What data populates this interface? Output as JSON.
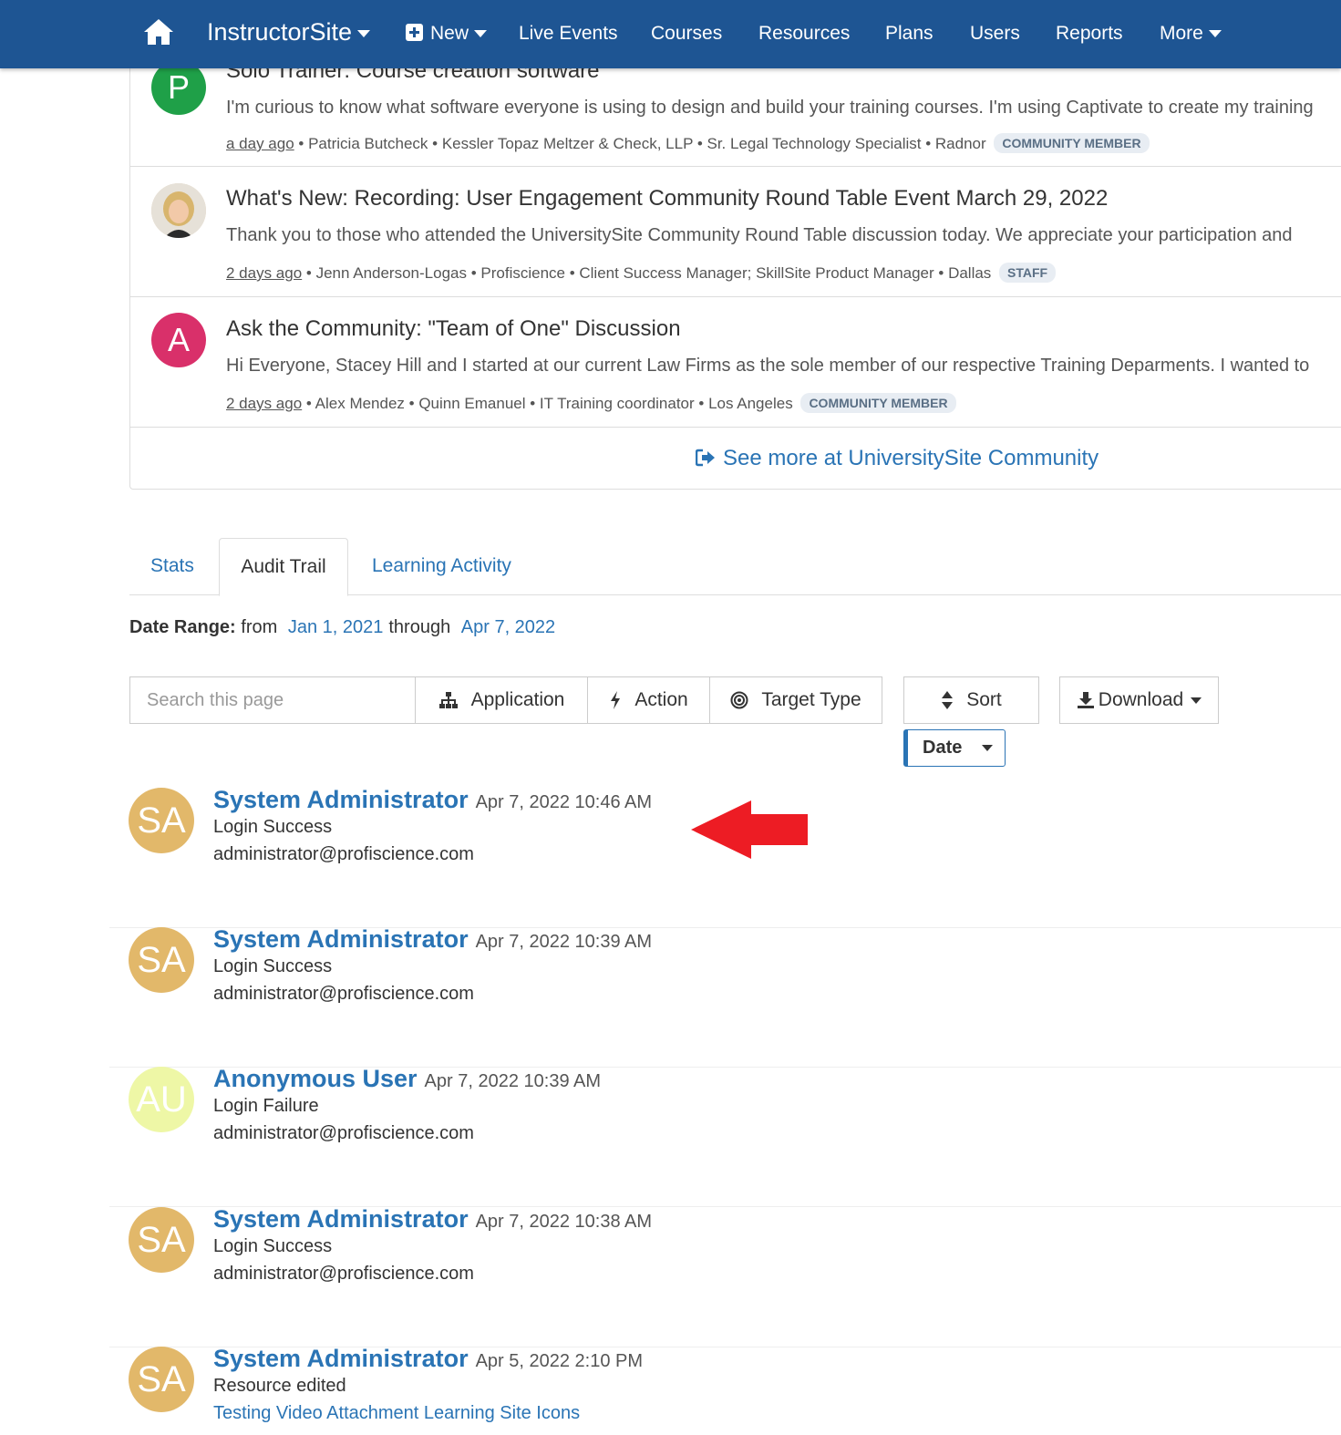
{
  "nav": {
    "brand": "InstructorSite",
    "new_label": "New",
    "items": [
      "Live Events",
      "Courses",
      "Resources",
      "Plans",
      "Users",
      "Reports"
    ],
    "more_label": "More"
  },
  "community": {
    "posts": [
      {
        "initial": "P",
        "avatar_color": "#1fa048",
        "title": "Solo Trainer: Course creation software",
        "body": "I'm curious to know what software everyone is using to design and build your training courses. I'm using Captivate to create my training",
        "ago": "a day ago",
        "meta": " • Patricia Butcheck • Kessler Topaz Meltzer & Check, LLP • Sr. Legal Technology Specialist • Radnor",
        "badge": "COMMUNITY MEMBER"
      },
      {
        "initial": "",
        "avatar_color": "#e9d3b8",
        "title": "What's New: Recording: User Engagement Community Round Table Event March 29, 2022",
        "body": "Thank you to those who attended the UniversitySite Community Round Table discussion today. We appreciate your participation and",
        "ago": "2 days ago",
        "meta": " • Jenn Anderson-Logas • Profiscience • Client Success Manager; SkillSite Product Manager • Dallas",
        "badge": "STAFF"
      },
      {
        "initial": "A",
        "avatar_color": "#d9306a",
        "title": "Ask the Community: \"Team of One\" Discussion",
        "body": "Hi Everyone, Stacey Hill and I started at our current Law Firms as the sole member of our respective Training Deparments. I wanted to",
        "ago": "2 days ago",
        "meta": " • Alex Mendez • Quinn Emanuel • IT Training coordinator • Los Angeles",
        "badge": "COMMUNITY MEMBER"
      }
    ],
    "see_more": "See more at UniversitySite Community"
  },
  "tabs": [
    "Stats",
    "Audit Trail",
    "Learning Activity"
  ],
  "date_range": {
    "label": "Date Range:",
    "from_word": "from",
    "from": "Jan 1, 2021",
    "through_word": "through",
    "to": "Apr 7, 2022"
  },
  "toolbar": {
    "search_placeholder": "Search this page",
    "application": "Application",
    "action": "Action",
    "target_type": "Target Type",
    "sort": "Sort",
    "download": "Download",
    "sort_by": "Date"
  },
  "entries": [
    {
      "initials": "SA",
      "color": "#e2b86a",
      "user": "System Administrator",
      "time": "Apr 7, 2022 10:46 AM",
      "action": "Login Success",
      "target": "administrator@profiscience.com",
      "target_link": false
    },
    {
      "initials": "SA",
      "color": "#e2b86a",
      "user": "System Administrator",
      "time": "Apr 7, 2022 10:39 AM",
      "action": "Login Success",
      "target": "administrator@profiscience.com",
      "target_link": false
    },
    {
      "initials": "AU",
      "color": "#eef7a6",
      "user": "Anonymous User",
      "time": "Apr 7, 2022 10:39 AM",
      "action": "Login Failure",
      "target": "administrator@profiscience.com",
      "target_link": false
    },
    {
      "initials": "SA",
      "color": "#e2b86a",
      "user": "System Administrator",
      "time": "Apr 7, 2022 10:38 AM",
      "action": "Login Success",
      "target": "administrator@profiscience.com",
      "target_link": false
    },
    {
      "initials": "SA",
      "color": "#e2b86a",
      "user": "System Administrator",
      "time": "Apr 5, 2022 2:10 PM",
      "action": "Resource edited",
      "target": "Testing Video Attachment Learning Site Icons",
      "target_link": true
    }
  ],
  "colors": {
    "nav": "#1e5593",
    "link": "#2a74b5",
    "arrow": "#ed1c24"
  }
}
